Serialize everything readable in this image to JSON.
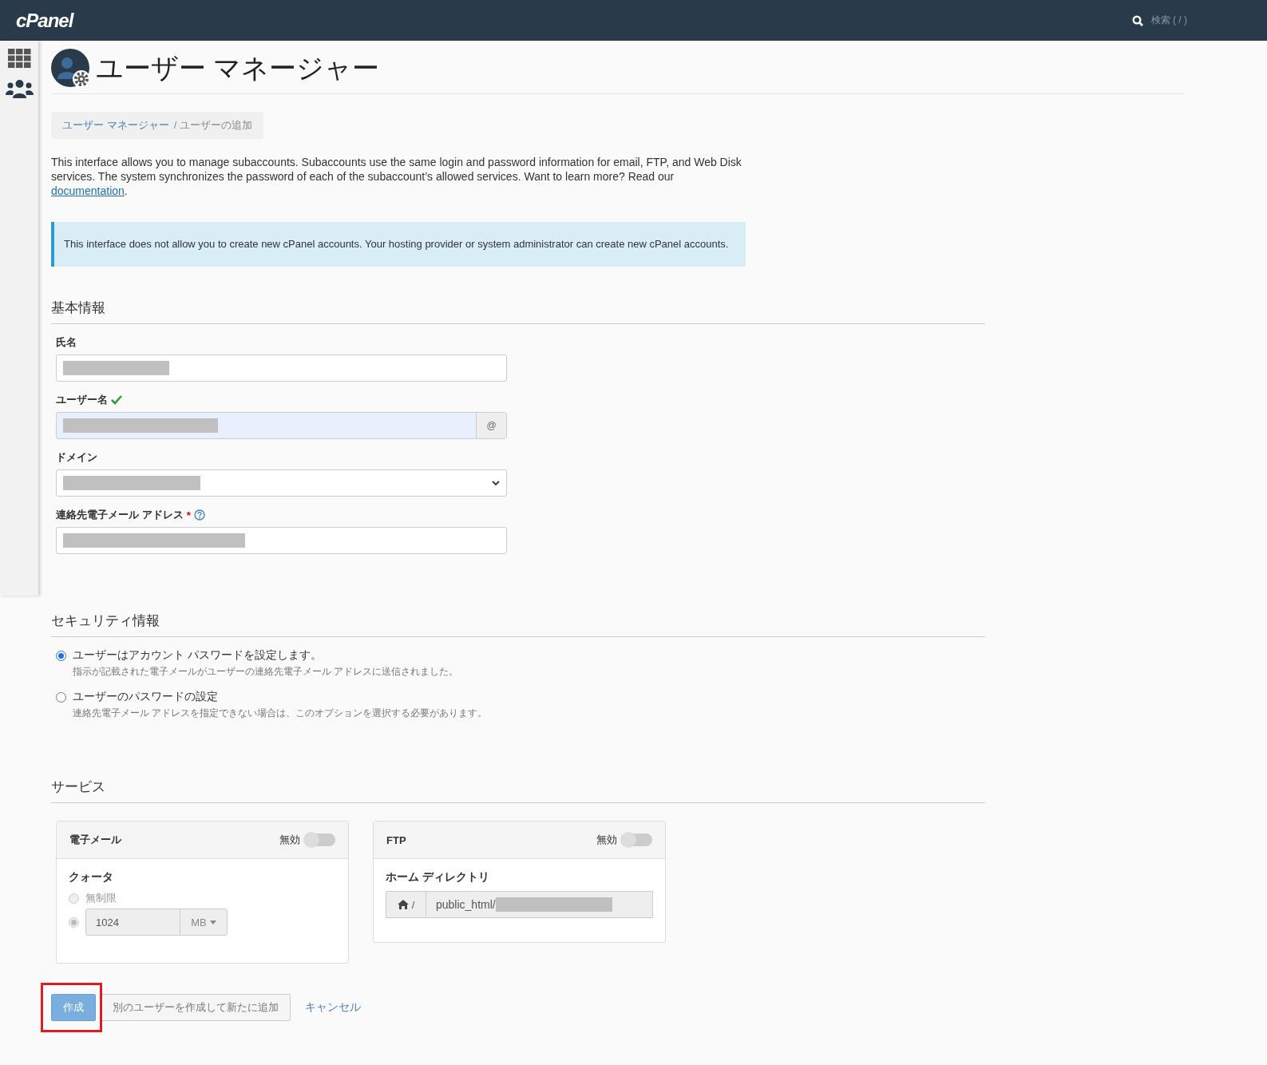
{
  "header": {
    "logo": "cPanel",
    "search_placeholder": "検索 ( / )"
  },
  "sidebar": {
    "items": [
      {
        "kind": "grid",
        "selected": false
      },
      {
        "kind": "users",
        "selected": true
      }
    ]
  },
  "page": {
    "title": "ユーザー マネージャー"
  },
  "breadcrumb": [
    {
      "label": "ユーザー マネージャー",
      "link": true
    },
    {
      "label": "/ ユーザーの追加",
      "link": false
    }
  ],
  "intro": {
    "text": "This interface allows you to manage subaccounts. Subaccounts use the same login and password information for email, FTP, and Web Disk services. The system synchronizes the password of each of the subaccount’s allowed services. Want to learn more? Read our",
    "link": "documentation",
    "end": "."
  },
  "alert": "This interface does not allow you to create new cPanel accounts. Your hosting provider or system administrator can create new cPanel accounts.",
  "basic_info": {
    "heading": "基本情報",
    "fields": [
      {
        "label": "氏名",
        "kind": "text",
        "valid": false,
        "help": false,
        "autofilled": false,
        "redacted": true
      },
      {
        "label": "ユーザー名",
        "kind": "addon",
        "valid": true,
        "help": false,
        "autofilled": true,
        "redacted": true,
        "addon": "@"
      },
      {
        "label": "ドメイン",
        "kind": "select",
        "valid": false,
        "help": false,
        "autofilled": false,
        "redacted": true
      },
      {
        "label": "連絡先電子メール アドレス",
        "kind": "text",
        "valid": false,
        "required_mark": "*",
        "help": true,
        "autofilled": false,
        "redacted": true
      }
    ]
  },
  "security": {
    "heading": "セキュリティ情報",
    "options": [
      {
        "label": "ユーザーはアカウント パスワードを設定します。",
        "hint": "指示が記載された電子メールがユーザーの連絡先電子メール アドレスに送信されました。",
        "selected": true
      },
      {
        "label": "ユーザーのパスワードの設定",
        "hint": "連絡先電子メール アドレスを指定できない場合は、このオプションを選択する必要があります。",
        "selected": false
      }
    ]
  },
  "services": {
    "heading": "サービス",
    "cards": [
      {
        "kind": "email",
        "title": "電子メール",
        "status": "無効",
        "on": false,
        "section": "クォータ",
        "options": [
          {
            "label": "無制限",
            "selected": false,
            "disabled": true
          },
          {
            "kind": "amount",
            "value": "1024",
            "unit": "MB",
            "selected": true,
            "disabled": true
          }
        ]
      },
      {
        "kind": "ftp",
        "title": "FTP",
        "status": "無効",
        "on": false,
        "section": "ホーム ディレクトリ",
        "prefix": "/",
        "value": "public_html/",
        "redacted": true
      }
    ]
  },
  "actions": [
    {
      "kind": "primary",
      "label": "作成",
      "highlighted": true
    },
    {
      "kind": "secondary",
      "label": "別のユーザーを作成して新たに追加",
      "highlighted": false
    },
    {
      "kind": "link",
      "label": "キャンセル",
      "highlighted": false
    }
  ]
}
